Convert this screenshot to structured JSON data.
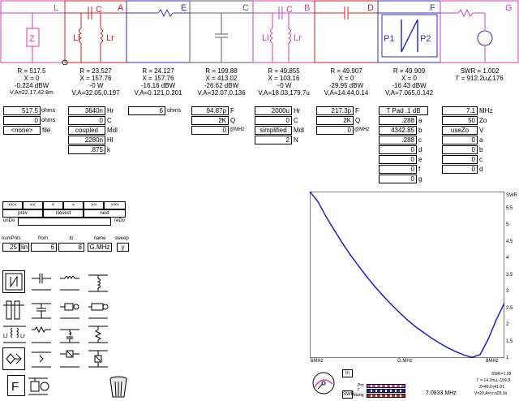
{
  "schematic": {
    "blocks": [
      {
        "letter": "L",
        "color": "#d23cb4"
      },
      {
        "letter": "A",
        "color": "#d02020",
        "component_labels": [
          "C",
          "Ll",
          "Lr"
        ]
      },
      {
        "letter": "E",
        "color": "#3030c0"
      },
      {
        "letter": "C",
        "color": "#606060"
      },
      {
        "letter": "B",
        "color": "#d23cb4",
        "component_labels": [
          "C",
          "Ll",
          "Lr"
        ]
      },
      {
        "letter": "D",
        "color": "#d02020"
      },
      {
        "letter": "F",
        "color": "#3030c0",
        "component_labels": [
          "P1",
          "P2"
        ]
      },
      {
        "letter": "G",
        "color": "#d23cb4"
      }
    ],
    "source_label": "Z"
  },
  "readouts": {
    "L": {
      "r": "R = 517.5",
      "x": "X = 0",
      "dbw": "-0.224 dBW",
      "va": "V,A=22.17,42.8m"
    },
    "A": {
      "r": "R = 23.527",
      "x": "X = 157.76",
      "dbw": "~0 W",
      "va": "V,A=32.05,0.197"
    },
    "E": {
      "r": "R = 24.127",
      "x": "X = 157.76",
      "dbw": "-16.16 dBW",
      "va": "V,A=0.121,0.201"
    },
    "C": {
      "r": "R = 199.88",
      "x": "X = 413.02",
      "dbw": "-26.62 dBW",
      "va": "V,A=32.07,0.136"
    },
    "B": {
      "r": "R = 49.855",
      "x": "X = 103.16",
      "dbw": "~0 W",
      "va": "V,A=18.03,179.7u"
    },
    "D": {
      "r": "R = 49.907",
      "x": "X = 0",
      "dbw": "-29.95 dBW",
      "va": "V,A=14.44,0.14"
    },
    "F": {
      "r": "R = 49.909",
      "x": "X = 0",
      "dbw": "-16.43 dBW",
      "va": "V,A=7.065,0.142"
    },
    "G": {
      "swr": "SWR = 1.002",
      "gamma": "Γ = 912.2u∠176"
    }
  },
  "params": {
    "L": {
      "val1": "517.5",
      "unit1": "ohms",
      "val2": "0",
      "unit2": "ohms",
      "file_btn": "<none>",
      "file_lbl": "file"
    },
    "A": {
      "hr": "3640n",
      "hr_l": "Hr",
      "c": "0",
      "c_l": "C",
      "mdl": "coupled",
      "mdl_l": "Mdl",
      "hl": "2280n",
      "hl_l": "Hl",
      "k": ".875",
      "k_l": "k"
    },
    "E": {
      "val": "6",
      "unit": "ohms"
    },
    "C": {
      "f": "94.87p",
      "f_l": "F",
      "q": "2K",
      "q_l": "Q",
      "at": "0",
      "at_l": "@MHz"
    },
    "B": {
      "hr": "2000u",
      "hr_l": "Hr",
      "c": "0",
      "c_l": "C",
      "mdl": "simplified",
      "mdl_l": "Mdl",
      "n": "2",
      "n_l": "N"
    },
    "D": {
      "f": "217.3p",
      "f_l": "F",
      "q": "2K",
      "q_l": "Q",
      "at": "0",
      "at_l": "@MHz"
    },
    "F": {
      "type": "T Pad .1 dB",
      "rows": [
        {
          "v": ".288",
          "l": "a"
        },
        {
          "v": "4342.85",
          "l": "b"
        },
        {
          "v": ".288",
          "l": "c"
        },
        {
          "v": "0",
          "l": "d"
        },
        {
          "v": "0",
          "l": "e"
        },
        {
          "v": "0",
          "l": "f"
        },
        {
          "v": "0",
          "l": "g"
        }
      ]
    },
    "G": {
      "rows": [
        {
          "v": "7.1",
          "l": "MHz"
        },
        {
          "v": "50",
          "l": "Zo"
        },
        {
          "v": "useZo",
          "l": "V"
        },
        {
          "v": "0",
          "l": "a"
        },
        {
          "v": "0",
          "l": "b"
        },
        {
          "v": "0",
          "l": "c"
        },
        {
          "v": "0",
          "l": "d"
        }
      ]
    }
  },
  "nav": {
    "arrows": [
      "<<<",
      "<<",
      "<",
      ">",
      ">>",
      ">>>"
    ],
    "prev": "prev",
    "closest": "closest",
    "next": "next",
    "undo": "unDo",
    "redo": "reDo",
    "sweep_headers": [
      "numPnts",
      "from",
      "to",
      "name",
      "sweep"
    ],
    "sweep_values": [
      "25",
      "lin",
      "6",
      "8",
      "G.MHz",
      "y"
    ]
  },
  "palette": {
    "icons": [
      "two-port-icon",
      "series-capacitor-icon",
      "series-inductor-icon",
      "shunt-inductor-icon",
      "series-line-icon",
      "shunt-capacitor-icon",
      "transformer-icon",
      "shunt-transformer-icon",
      "parallel-lc-icon",
      "series-resistor-icon",
      "series-rlc-icon",
      "shunt-resistor-icon",
      "feedline-icon",
      "sampler-icon",
      "series-box-icon",
      "shunt-box-icon",
      "file-icon",
      "source-icon",
      "trash-icon"
    ],
    "file_letter": "F"
  },
  "plot": {
    "y_axis_label": "SWR",
    "y_ticks": [
      "5.5",
      "5",
      "4.5",
      "4",
      "3.5",
      "3",
      "2.5",
      "2",
      "1.5",
      "1"
    ],
    "x_labels": [
      "6MHz",
      "G.MHz",
      "8MHz"
    ],
    "swr_readout": "SWR=1.09",
    "gamma_readout": "Γ = 14.7m∠-159.8",
    "z_readout": "Z=49.9-j41.01",
    "va_readout": "V=20,A=r.r.n05.3u",
    "freq_readout": "7.0833 MHz",
    "ln_btn": "ln",
    "swr_btn": "SWR",
    "legend_labels": [
      "Pm",
      "Γ",
      "startg"
    ]
  },
  "chart_data": {
    "type": "line",
    "title": "",
    "xlabel": "",
    "ylabel": "SWR",
    "xlim": [
      6,
      8
    ],
    "ylim": [
      1,
      6
    ],
    "grid": false,
    "series": [
      {
        "values": [
          [
            6.0,
            6.0
          ],
          [
            6.083,
            5.7
          ],
          [
            6.167,
            5.25
          ],
          [
            6.25,
            4.85
          ],
          [
            6.333,
            4.46
          ],
          [
            6.417,
            4.1
          ],
          [
            6.5,
            3.77
          ],
          [
            6.583,
            3.45
          ],
          [
            6.667,
            3.15
          ],
          [
            6.75,
            2.88
          ],
          [
            6.833,
            2.62
          ],
          [
            6.917,
            2.38
          ],
          [
            7.0,
            2.15
          ],
          [
            7.083,
            1.95
          ],
          [
            7.167,
            1.77
          ],
          [
            7.25,
            1.6
          ],
          [
            7.333,
            1.45
          ],
          [
            7.417,
            1.31
          ],
          [
            7.5,
            1.19
          ],
          [
            7.583,
            1.09
          ],
          [
            7.667,
            1.02
          ],
          [
            7.75,
            1.1
          ],
          [
            7.833,
            1.56
          ],
          [
            7.917,
            2.15
          ],
          [
            8.0,
            2.65
          ]
        ]
      }
    ]
  }
}
